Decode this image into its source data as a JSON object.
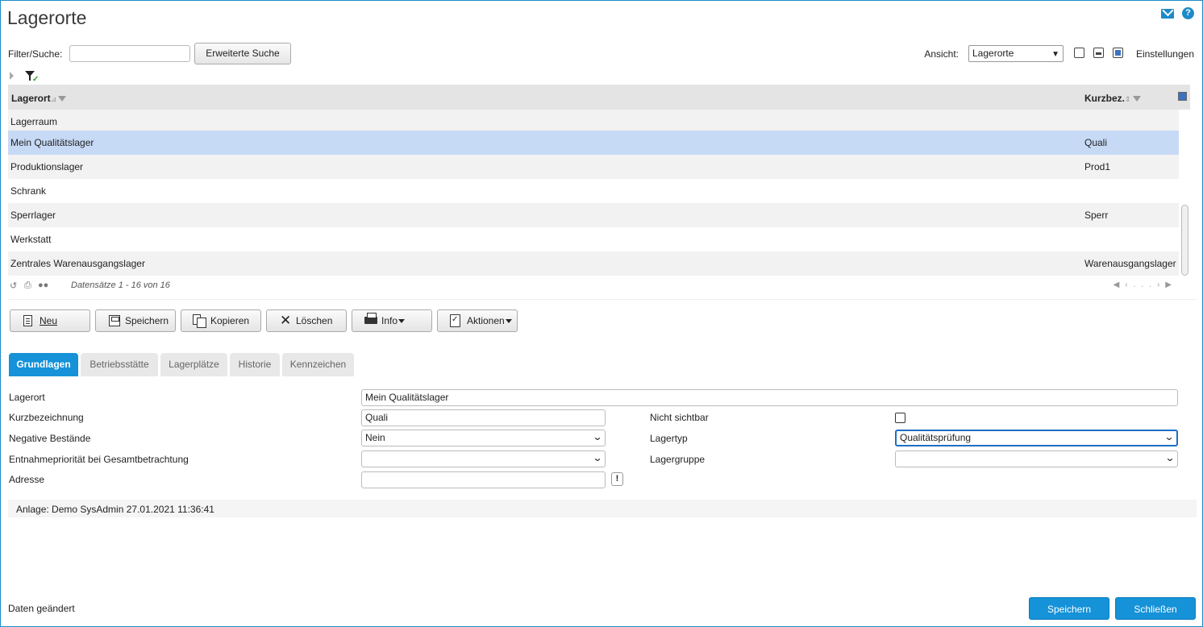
{
  "header": {
    "title": "Lagerorte"
  },
  "top_icons": {
    "mail": "mail-icon",
    "help": "help-icon",
    "help_glyph": "?"
  },
  "filter": {
    "label": "Filter/Suche:",
    "value": "",
    "extended_search_label": "Erweiterte Suche"
  },
  "view": {
    "label": "Ansicht:",
    "selected": "Lagerorte",
    "settings_label": "Einstellungen"
  },
  "grid": {
    "columns": [
      "Lagerort",
      "Kurzbez."
    ],
    "rows": [
      {
        "lagerort": "Lagerraum",
        "kurz": ""
      },
      {
        "lagerort": "Mein Qualitätslager",
        "kurz": "Quali",
        "selected": true
      },
      {
        "lagerort": "Produktionslager",
        "kurz": "Prod1"
      },
      {
        "lagerort": "Schrank",
        "kurz": ""
      },
      {
        "lagerort": "Sperrlager",
        "kurz": "Sperr"
      },
      {
        "lagerort": "Werkstatt",
        "kurz": ""
      },
      {
        "lagerort": "Zentrales Warenausgangslager",
        "kurz": "Warenausgangslager"
      }
    ],
    "pager_info": "Datensätze 1 - 16 von 16",
    "pager_ellipsis": "..."
  },
  "toolbar": {
    "new_label": "Neu",
    "save_label": "Speichern",
    "copy_label": "Kopieren",
    "delete_label": "Löschen",
    "info_label": "Info",
    "actions_label": "Aktionen"
  },
  "tabs": [
    "Grundlagen",
    "Betriebsstätte",
    "Lagerplätze",
    "Historie",
    "Kennzeichen"
  ],
  "form": {
    "lagerort_label": "Lagerort",
    "lagerort_value": "Mein Qualitätslager",
    "kurz_label": "Kurzbezeichnung",
    "kurz_value": "Quali",
    "nicht_sichtbar_label": "Nicht sichtbar",
    "neg_label": "Negative Bestände",
    "neg_value": "Nein",
    "lagertyp_label": "Lagertyp",
    "lagertyp_value": "Qualitätsprüfung",
    "entnahme_label": "Entnahmepriorität bei Gesamtbetrachtung",
    "entnahme_value": "",
    "lagergruppe_label": "Lagergruppe",
    "lagergruppe_value": "",
    "adresse_label": "Adresse",
    "adresse_value": "",
    "adresse_btn": "!"
  },
  "audit": "Anlage: Demo SysAdmin 27.01.2021 11:36:41",
  "footer": {
    "status": "Daten geändert",
    "save_label": "Speichern",
    "close_label": "Schließen"
  },
  "colors": {
    "accent": "#1592d8",
    "selected_row": "#c6d9f5"
  }
}
